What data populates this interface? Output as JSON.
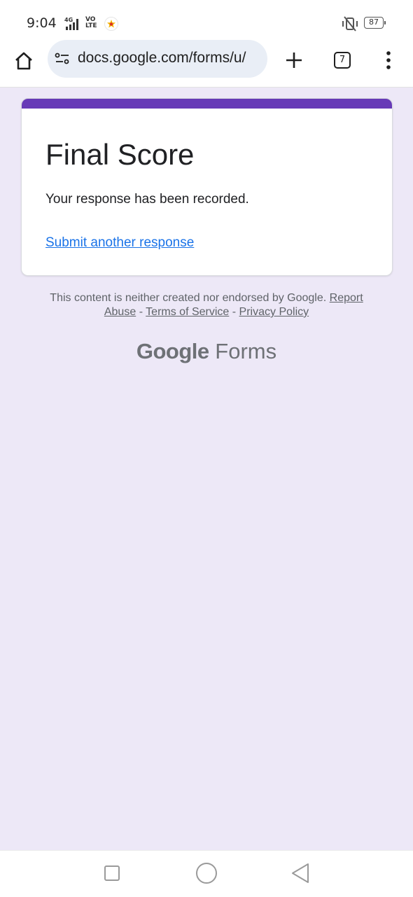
{
  "status_bar": {
    "time": "9:04",
    "network": "4G",
    "volte_top": "VO",
    "volte_bottom": "LTE",
    "battery": "87"
  },
  "browser": {
    "url": "docs.google.com/forms/u/",
    "tab_count": "7"
  },
  "form": {
    "accent_color": "#673ab7",
    "title": "Final Score",
    "message": "Your response has been recorded.",
    "submit_another_link": "Submit another response"
  },
  "footer": {
    "disclaimer_text": "This content is neither created nor endorsed by Google.",
    "report_abuse_link": "Report Abuse",
    "separator_1": "-",
    "terms_link": "Terms of Service",
    "separator_2": "-",
    "privacy_link": "Privacy Policy",
    "brand_google": "Google",
    "brand_forms": "Forms"
  },
  "colors": {
    "page_background": "#ede8f7",
    "link": "#1a73e8"
  }
}
